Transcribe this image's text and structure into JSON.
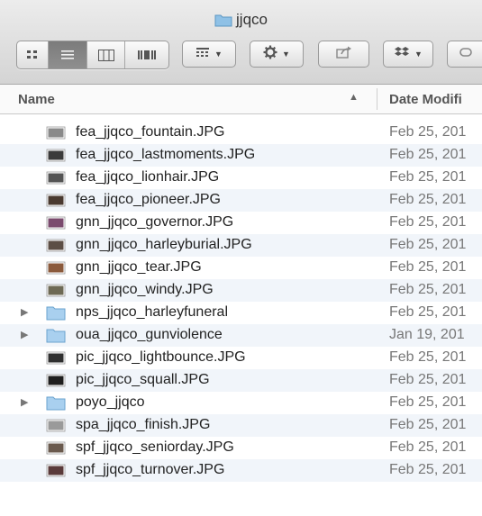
{
  "window": {
    "title": "jjqco"
  },
  "header": {
    "name_label": "Name",
    "date_label": "Date Modifi"
  },
  "rows": [
    {
      "name": "fea_jjqco_fountain.JPG",
      "date": "Feb 25, 201",
      "kind": "image",
      "thumb": "#8a8a8a",
      "has_disclosure": false
    },
    {
      "name": "fea_jjqco_lastmoments.JPG",
      "date": "Feb 25, 201",
      "kind": "image",
      "thumb": "#3b3b3b",
      "has_disclosure": false
    },
    {
      "name": "fea_jjqco_lionhair.JPG",
      "date": "Feb 25, 201",
      "kind": "image",
      "thumb": "#545454",
      "has_disclosure": false
    },
    {
      "name": "fea_jjqco_pioneer.JPG",
      "date": "Feb 25, 201",
      "kind": "image",
      "thumb": "#4a3a30",
      "has_disclosure": false
    },
    {
      "name": "gnn_jjqco_governor.JPG",
      "date": "Feb 25, 201",
      "kind": "image",
      "thumb": "#7b4b6e",
      "has_disclosure": false
    },
    {
      "name": "gnn_jjqco_harleyburial.JPG",
      "date": "Feb 25, 201",
      "kind": "image",
      "thumb": "#5c4e45",
      "has_disclosure": false
    },
    {
      "name": "gnn_jjqco_tear.JPG",
      "date": "Feb 25, 201",
      "kind": "image",
      "thumb": "#8b5a3c",
      "has_disclosure": false
    },
    {
      "name": "gnn_jjqco_windy.JPG",
      "date": "Feb 25, 201",
      "kind": "image",
      "thumb": "#6e6a55",
      "has_disclosure": false
    },
    {
      "name": "nps_jjqco_harleyfuneral",
      "date": "Feb 25, 201",
      "kind": "folder",
      "has_disclosure": true
    },
    {
      "name": "oua_jjqco_gunviolence",
      "date": "Jan 19, 201",
      "kind": "folder",
      "has_disclosure": true
    },
    {
      "name": "pic_jjqco_lightbounce.JPG",
      "date": "Feb 25, 201",
      "kind": "image",
      "thumb": "#2f2f2f",
      "has_disclosure": false
    },
    {
      "name": "pic_jjqco_squall.JPG",
      "date": "Feb 25, 201",
      "kind": "image",
      "thumb": "#1f1f1f",
      "has_disclosure": false
    },
    {
      "name": "poyo_jjqco",
      "date": "Feb 25, 201",
      "kind": "folder",
      "has_disclosure": true
    },
    {
      "name": "spa_jjqco_finish.JPG",
      "date": "Feb 25, 201",
      "kind": "image",
      "thumb": "#9a9a9a",
      "has_disclosure": false
    },
    {
      "name": "spf_jjqco_seniorday.JPG",
      "date": "Feb 25, 201",
      "kind": "image",
      "thumb": "#6a5a4e",
      "has_disclosure": false
    },
    {
      "name": "spf_jjqco_turnover.JPG",
      "date": "Feb 25, 201",
      "kind": "image",
      "thumb": "#5a3b3b",
      "has_disclosure": false
    }
  ],
  "toolbar": {
    "icons": [
      "icon-view-icon",
      "list-view-icon",
      "column-view-icon",
      "coverflow-view-icon",
      "arrange-icon",
      "gear-icon",
      "share-icon",
      "dropbox-icon",
      "tags-icon"
    ]
  }
}
